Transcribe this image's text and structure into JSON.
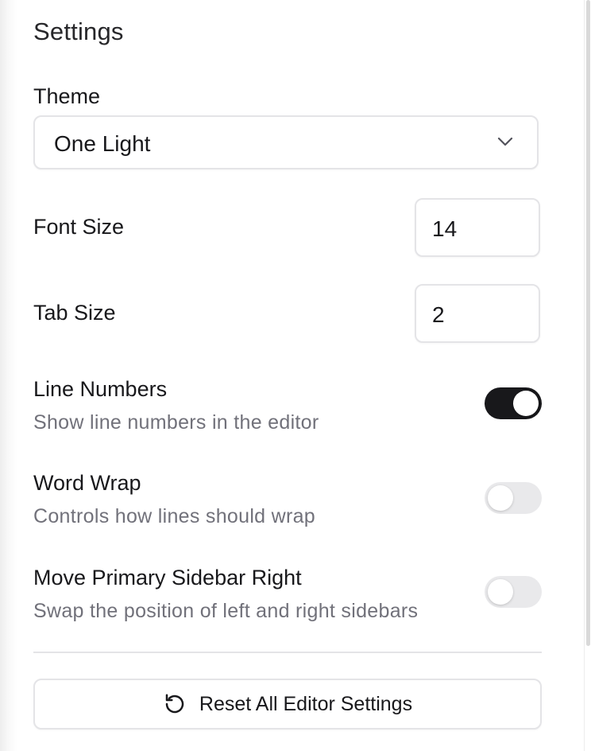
{
  "settings": {
    "title": "Settings"
  },
  "theme": {
    "label": "Theme",
    "selected": "One Light"
  },
  "font_size": {
    "label": "Font Size",
    "value": "14"
  },
  "tab_size": {
    "label": "Tab Size",
    "value": "2"
  },
  "toggles": [
    {
      "title": "Line Numbers",
      "description": "Show line numbers in the editor",
      "enabled": true
    },
    {
      "title": "Word Wrap",
      "description": "Controls how lines should wrap",
      "enabled": false
    },
    {
      "title": "Move Primary Sidebar Right",
      "description": "Swap the position of left and right sidebars",
      "enabled": false
    }
  ],
  "reset": {
    "label": "Reset All Editor Settings"
  },
  "icons": {
    "theme_chevron": "chevron-down-icon",
    "reset": "rotate-ccw-icon"
  },
  "colors": {
    "switch_on": "#18181b",
    "switch_off": "#e9e9eb",
    "muted_text": "#71717a",
    "border": "#e4e4e7"
  }
}
